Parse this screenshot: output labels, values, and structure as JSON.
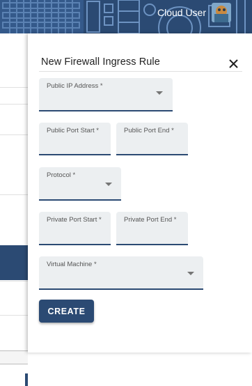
{
  "header": {
    "user_name": "Cloud User"
  },
  "drawer": {
    "title": "New Firewall Ingress Rule",
    "fields": {
      "public_ip": "Public IP Address *",
      "public_port_start": "Public Port Start *",
      "public_port_end": "Public Port End *",
      "protocol": "Protocol *",
      "private_port_start": "Private Port Start *",
      "private_port_end": "Private Port End *",
      "virtual_machine": "Virtual Machine *"
    },
    "create_label": "CREATE"
  },
  "colors": {
    "primary": "#2b4a73",
    "field_background": "#eceff1"
  },
  "icons": {
    "close": "close-icon",
    "dropdown": "chevron-down-icon"
  }
}
